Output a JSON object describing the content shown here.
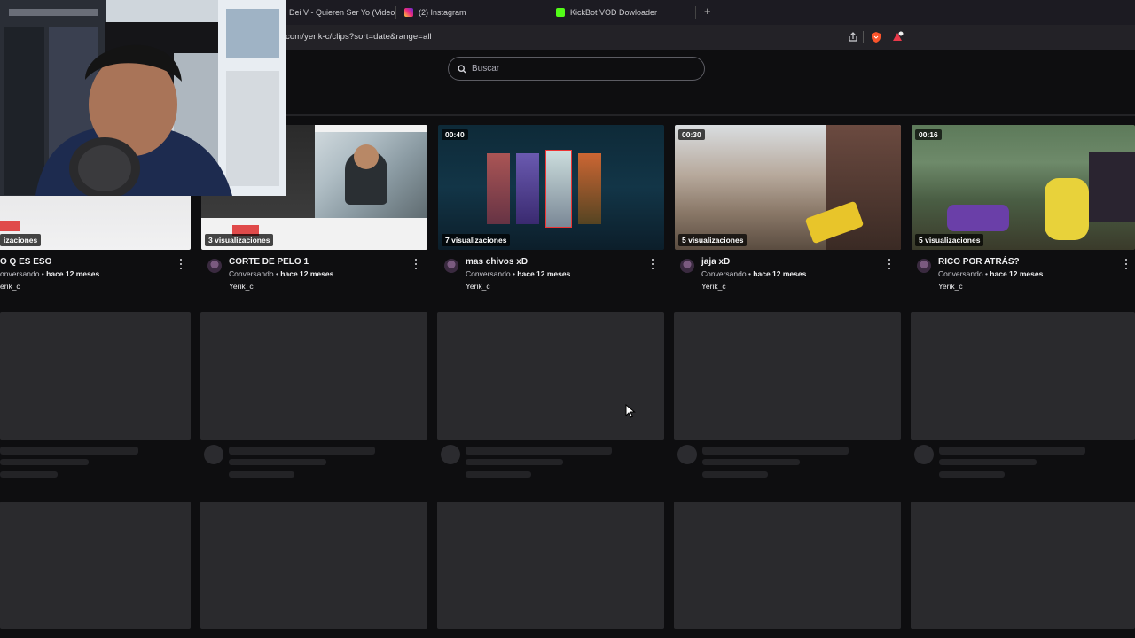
{
  "browser": {
    "tabs": [
      {
        "title": "Dei V - Quieren Ser Yo (Video",
        "favicon_color": "#c0392b"
      },
      {
        "title": "(2) Instagram",
        "favicon_color": "#d6249f"
      },
      {
        "title": "KickBot VOD Dowloader",
        "favicon_color": "#53fc18"
      }
    ],
    "new_tab_label": "+",
    "url": "com/yerik-c/clips?sort=date&range=all"
  },
  "search": {
    "placeholder": "Buscar"
  },
  "clips": [
    {
      "title": "O Q ES ESO",
      "views": "izaciones",
      "category": "onversando",
      "age": "hace 12 meses",
      "channel": "erik_c",
      "duration": ""
    },
    {
      "title": "CORTE DE PELO 1",
      "views": "3 visualizaciones",
      "category": "Conversando",
      "age": "hace 12 meses",
      "channel": "Yerik_c",
      "duration": ""
    },
    {
      "title": "mas chivos xD",
      "views": "7 visualizaciones",
      "category": "Conversando",
      "age": "hace 12 meses",
      "channel": "Yerik_c",
      "duration": "00:40"
    },
    {
      "title": "jaja xD",
      "views": "5 visualizaciones",
      "category": "Conversando",
      "age": "hace 12 meses",
      "channel": "Yerik_c",
      "duration": "00:30"
    },
    {
      "title": "RICO POR ATRÁS?",
      "views": "5 visualizaciones",
      "category": "Conversando",
      "age": "hace 12 meses",
      "channel": "Yerik_c",
      "duration": "00:16"
    }
  ],
  "meta_separator": "•",
  "colors": {
    "background": "#0e0e10",
    "skeleton": "#2a2a2d",
    "text": "#efeff1"
  }
}
